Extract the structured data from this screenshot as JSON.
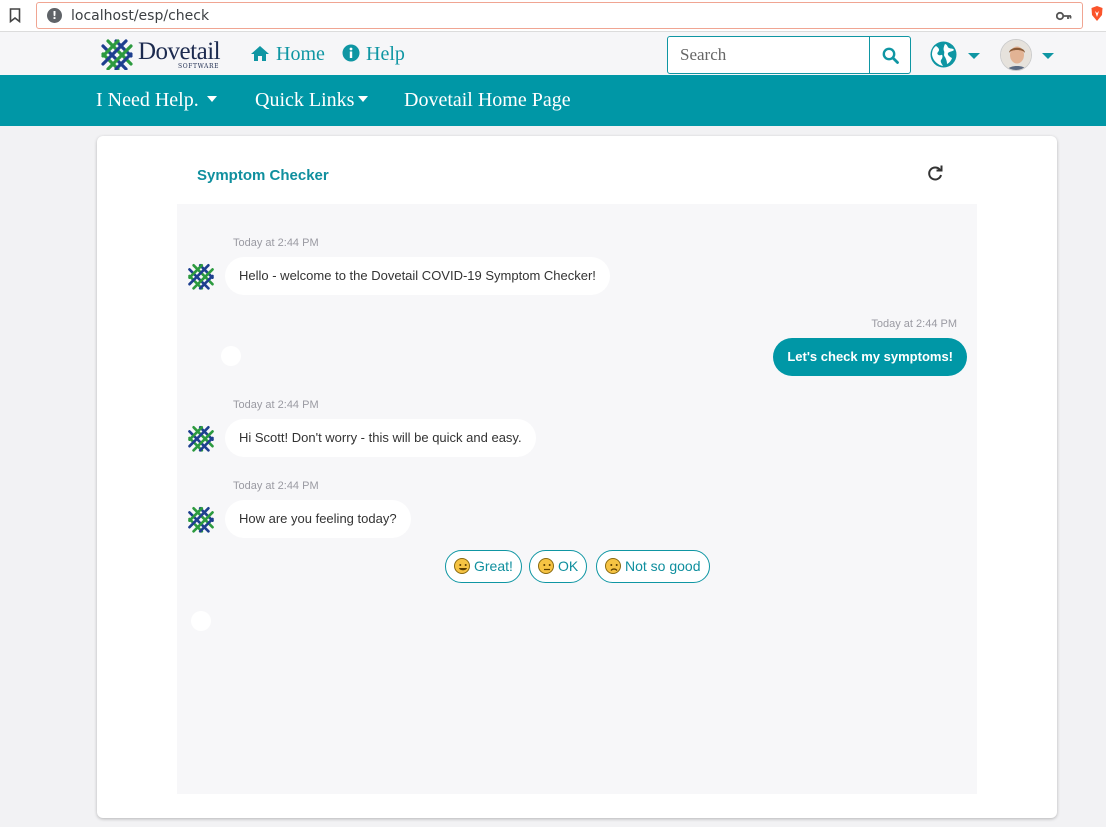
{
  "browser": {
    "url": "localhost/esp/check"
  },
  "header": {
    "logo_text": "Dovetail",
    "logo_subtext": "SOFTWARE",
    "home_label": "Home",
    "help_label": "Help",
    "search_placeholder": "Search"
  },
  "navbar": {
    "items": [
      {
        "label": "I Need Help."
      },
      {
        "label": "Quick Links"
      },
      {
        "label": "Dovetail Home Page"
      }
    ]
  },
  "card": {
    "title": "Symptom Checker"
  },
  "chat": {
    "messages": [
      {
        "sender": "bot",
        "timestamp": "Today at 2:44 PM",
        "text": "Hello - welcome to the Dovetail COVID-19 Symptom Checker!"
      },
      {
        "sender": "user",
        "timestamp": "Today at 2:44 PM",
        "text": "Let's check my symptoms!"
      },
      {
        "sender": "bot",
        "timestamp": "Today at 2:44 PM",
        "text": "Hi Scott! Don't worry - this will be quick and easy."
      },
      {
        "sender": "bot",
        "timestamp": "Today at 2:44 PM",
        "text": "How are you feeling today?"
      }
    ],
    "choices": [
      {
        "label": "Great!",
        "icon": "grinning-face-icon"
      },
      {
        "label": "OK",
        "icon": "neutral-face-icon"
      },
      {
        "label": "Not so good",
        "icon": "frowning-face-icon"
      }
    ]
  },
  "colors": {
    "accent": "#0097a6",
    "background": "#f2f2f4"
  }
}
